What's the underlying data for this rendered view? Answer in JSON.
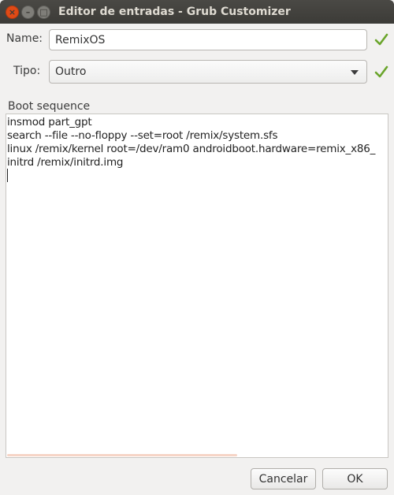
{
  "window": {
    "title": "Editor de entradas - Grub Customizer",
    "close_glyph": "×",
    "minimize_glyph": "–",
    "maximize_glyph": "□"
  },
  "form": {
    "name_label": "Name:",
    "name_value": "RemixOS",
    "type_label": "Tipo:",
    "type_value": "Outro",
    "valid_icon": "checkmark-icon",
    "valid_color": "#6aa52b"
  },
  "boot": {
    "label": "Boot sequence",
    "lines": [
      "insmod part_gpt",
      "search --file --no-floppy --set=root /remix/system.sfs",
      "linux /remix/kernel root=/dev/ram0 androidboot.hardware=remix_x86_",
      "initrd /remix/initrd.img"
    ]
  },
  "buttons": {
    "cancel": "Cancelar",
    "ok": "OK"
  }
}
